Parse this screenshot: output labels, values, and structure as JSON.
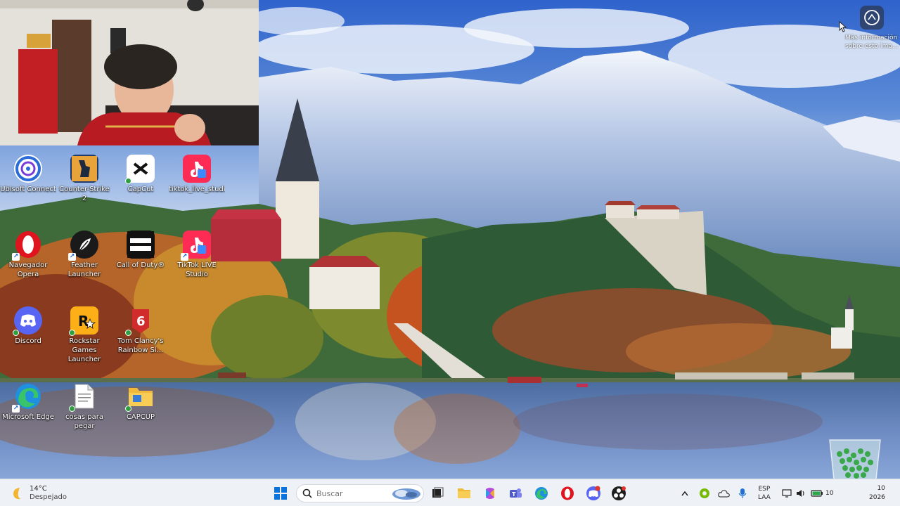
{
  "info": {
    "label": "Más información sobre esta ima..."
  },
  "desktop_icons": [
    {
      "label": "Ubisoft Connect"
    },
    {
      "label": "Counter-Strike 2"
    },
    {
      "label": "CapCut"
    },
    {
      "label": "tiktok_live_studi..."
    },
    {
      "label": "Navegador Opera"
    },
    {
      "label": "Feather Launcher"
    },
    {
      "label": "Call of Duty®"
    },
    {
      "label": "TikTok LIVE Studio"
    },
    {
      "label": "Discord"
    },
    {
      "label": "Rockstar Games Launcher"
    },
    {
      "label": "Tom Clancy's Rainbow Si..."
    },
    {
      "label": "Microsoft Edge"
    },
    {
      "label": "cosas para pegar"
    },
    {
      "label": "CAPCUP"
    }
  ],
  "taskbar": {
    "weather": {
      "temp": "14°C",
      "condition": "Despejado"
    },
    "search_placeholder": "Buscar",
    "tray": {
      "lang_top": "ESP",
      "lang_bottom": "LAA",
      "battery_text": "10",
      "clock_time": "10",
      "clock_date": "2026"
    }
  },
  "colors": {
    "taskbar_bg": "#eef1f6",
    "accent": "#0067c0"
  }
}
